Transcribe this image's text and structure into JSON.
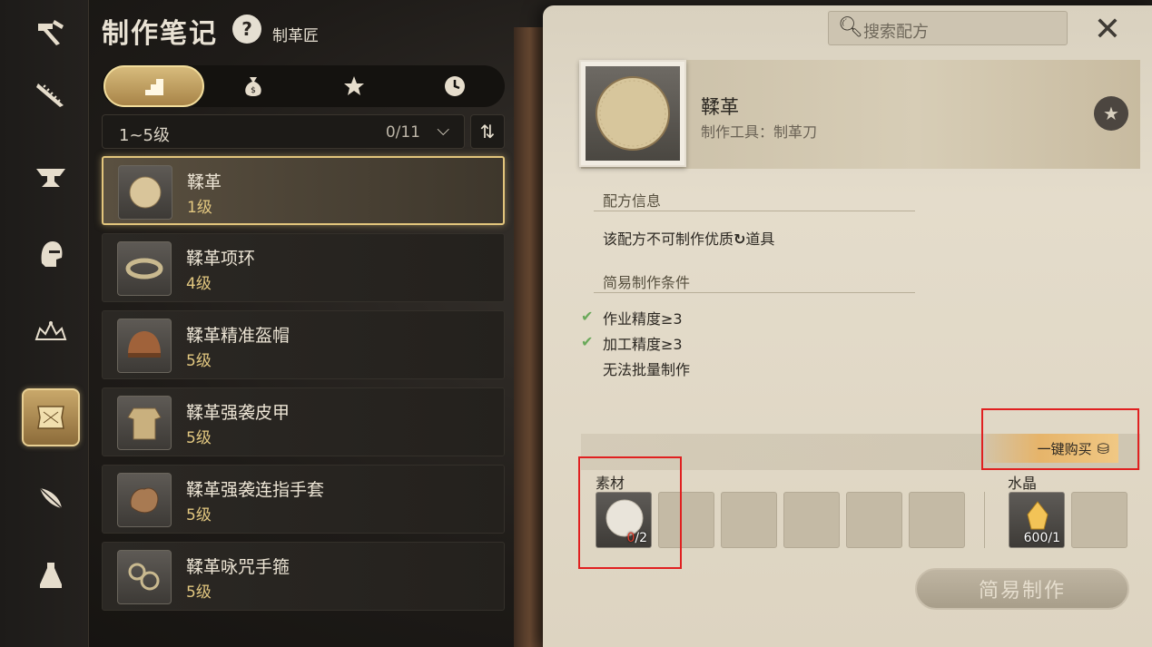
{
  "header": {
    "title": "制作笔记",
    "help": "?",
    "subtitle": "制革匠"
  },
  "sidebar": {
    "items": [
      {
        "icon": "hammer-icon"
      },
      {
        "icon": "saw-icon"
      },
      {
        "icon": "anvil-icon"
      },
      {
        "icon": "helmet-icon"
      },
      {
        "icon": "crown-icon"
      },
      {
        "icon": "leather-icon",
        "active": true
      },
      {
        "icon": "feather-icon"
      },
      {
        "icon": "alchemy-icon"
      }
    ]
  },
  "tabs": [
    {
      "icon": "stairs-icon",
      "active": true
    },
    {
      "icon": "moneybag-icon"
    },
    {
      "icon": "star-icon"
    },
    {
      "icon": "clock-icon"
    }
  ],
  "filter": {
    "level_range": "1~5级",
    "count": "0/11"
  },
  "recipes": [
    {
      "name": "鞣革",
      "level": "1级",
      "selected": true
    },
    {
      "name": "鞣革项环",
      "level": "4级"
    },
    {
      "name": "鞣革精准盔帽",
      "level": "5级"
    },
    {
      "name": "鞣革强袭皮甲",
      "level": "5级"
    },
    {
      "name": "鞣革强袭连指手套",
      "level": "5级"
    },
    {
      "name": "鞣革咏咒手箍",
      "level": "5级"
    }
  ],
  "search": {
    "placeholder": "搜索配方"
  },
  "detail": {
    "name": "鞣革",
    "tool": "制作工具：制革刀",
    "recipe_info_title": "配方信息",
    "recipe_info_text_before": "该配方不可制作优质",
    "recipe_info_text_after": "道具",
    "conditions_title": "简易制作条件",
    "conditions": [
      {
        "text": "作业精度≥3",
        "met": true
      },
      {
        "text": "加工精度≥3",
        "met": true
      },
      {
        "text": "无法批量制作",
        "met": null
      }
    ]
  },
  "materials": {
    "buy_label": "一键购买",
    "materials_label": "素材",
    "material_have": "0",
    "material_need": "/2",
    "crystal_label": "水晶",
    "crystal_count": "600",
    "crystal_need": "/1"
  },
  "craft_button": "简易制作",
  "colors": {
    "gold": "#e2c57c",
    "paper": "#e0d8c6",
    "highlight_red": "#e02020"
  }
}
